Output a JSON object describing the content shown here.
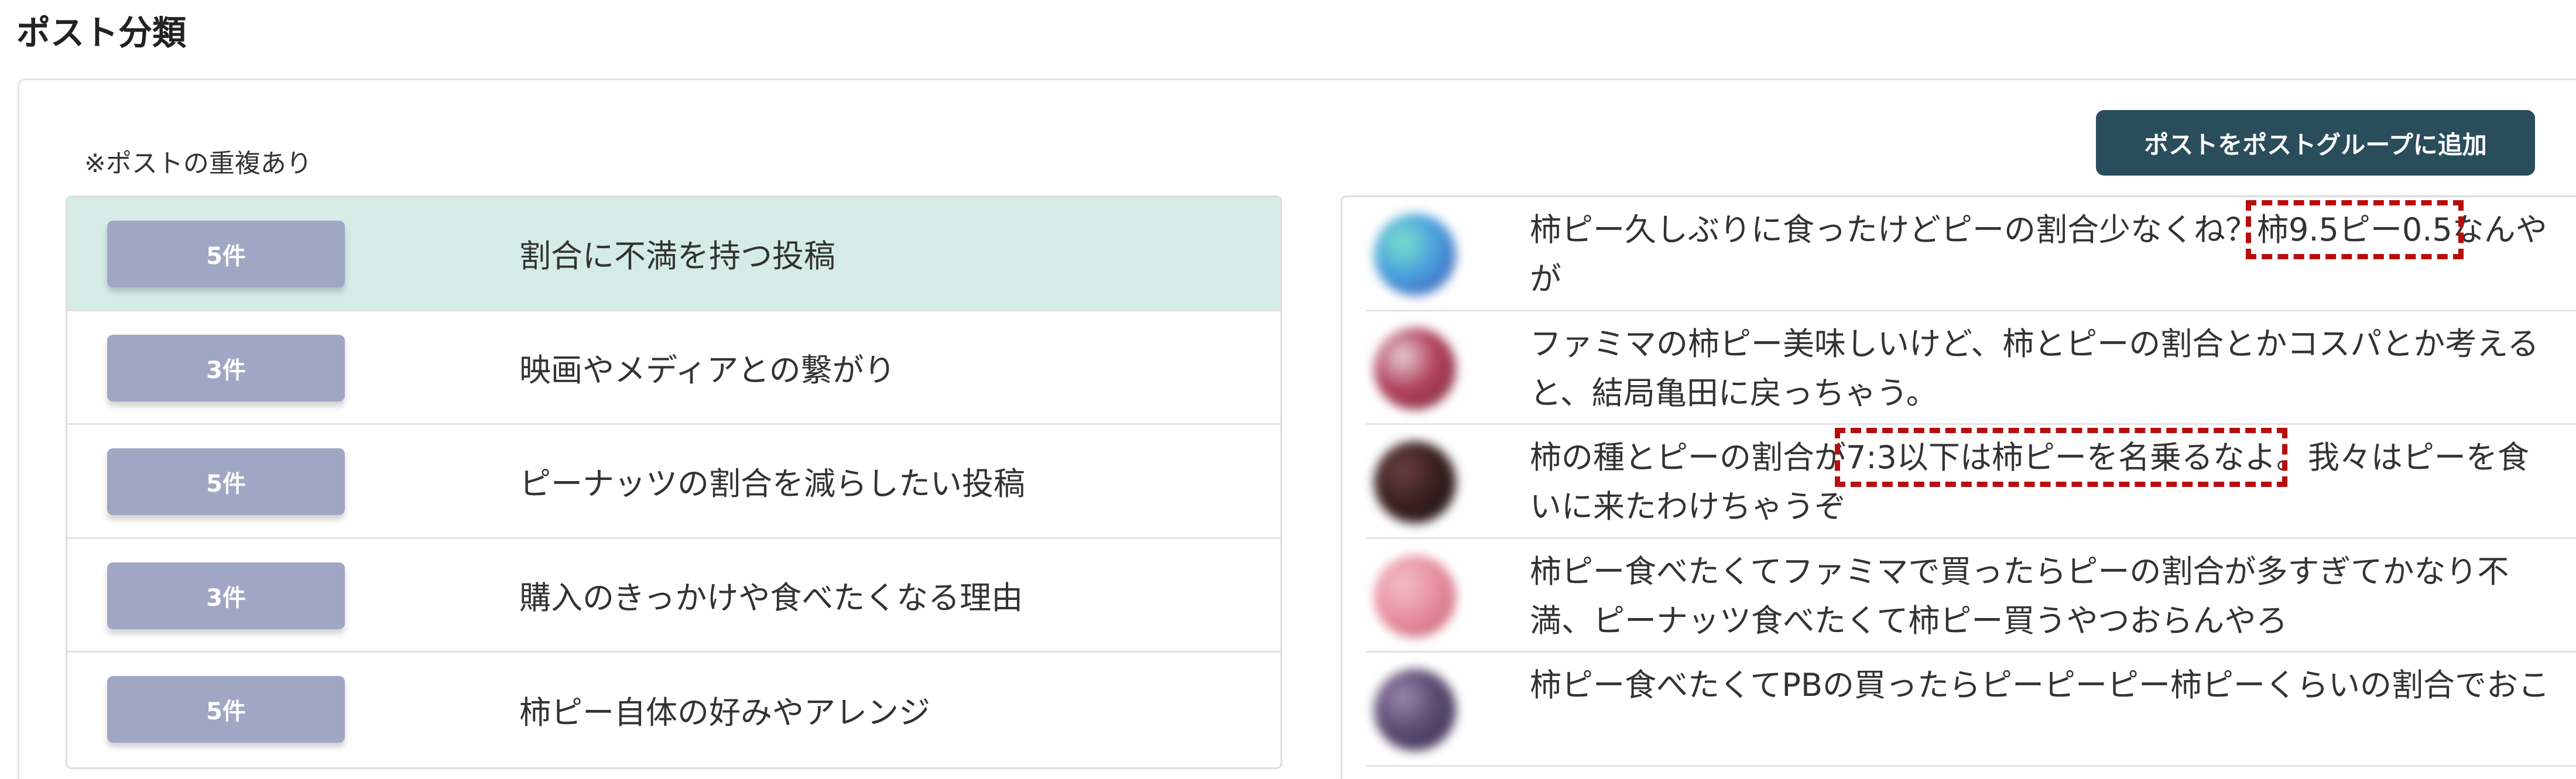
{
  "page": {
    "title": "ポスト分類"
  },
  "panel": {
    "duplicate_note": "※ポストの重複あり",
    "add_button_label": "ポストをポストグループに追加"
  },
  "categories": [
    {
      "count": "5件",
      "label": "割合に不満を持つ投稿",
      "selected": true
    },
    {
      "count": "3件",
      "label": "映画やメディアとの繋がり",
      "selected": false
    },
    {
      "count": "5件",
      "label": "ピーナッツの割合を減らしたい投稿",
      "selected": false
    },
    {
      "count": "3件",
      "label": "購入のきっかけや食べたくなる理由",
      "selected": false
    },
    {
      "count": "5件",
      "label": "柿ピー自体の好みやアレンジ",
      "selected": false
    }
  ],
  "posts": [
    {
      "avatar": "blurred-avatar",
      "avatar_colors": [
        "#4a9fe0",
        "#7be0c8",
        "#3b4fa8"
      ],
      "text_before": "柿ピー久しぶりに食ったけどピーの割合少なくね？",
      "highlight": "柿9.5ピー0.5",
      "text_after": "なんやが"
    },
    {
      "avatar": "blurred-avatar",
      "avatar_colors": [
        "#b0405a",
        "#e8d0d8",
        "#7a3040"
      ],
      "text_before": "ファミマの柿ピー美味しいけど、柿とピーの割合とかコスパとか考えると、結局亀田に戻っちゃう。",
      "highlight": "",
      "text_after": ""
    },
    {
      "avatar": "blurred-avatar",
      "avatar_colors": [
        "#3a2020",
        "#6a4040",
        "#1a1010"
      ],
      "text_before": "柿の種とピーの割合が",
      "highlight": "7:3以下は柿ピーを名乗るなよ",
      "text_after": "。我々はピーを食いに来たわけちゃうぞ"
    },
    {
      "avatar": "blurred-avatar",
      "avatar_colors": [
        "#e890a0",
        "#f4c0c8",
        "#c06070"
      ],
      "text_before": "柿ピー食べたくてファミマで買ったらピーの割合が多すぎてかなり不満、ピーナッツ食べたくて柿ピー買うやつおらんやろ",
      "highlight": "",
      "text_after": ""
    },
    {
      "avatar": "blurred-avatar",
      "avatar_colors": [
        "#5a4a70",
        "#9a88b0",
        "#3a3050"
      ],
      "text_before": "柿ピー食べたくてPBの買ったらピーピーピー柿ピーくらいの割合でおこ",
      "highlight": "",
      "text_after": ""
    }
  ]
}
